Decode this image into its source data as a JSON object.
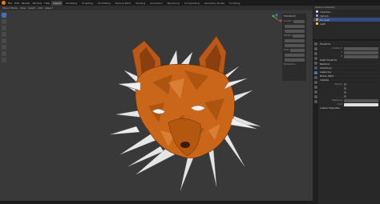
{
  "topbar": {
    "menus": [
      "File",
      "Edit",
      "Render",
      "Window",
      "Help"
    ],
    "workspaces": [
      "Layout",
      "Modeling",
      "Sculpting",
      "UV Editing",
      "Texture Paint",
      "Shading",
      "Animation",
      "Rendering",
      "Compositing",
      "Geometry Nodes",
      "Scripting"
    ],
    "active_workspace": "Layout"
  },
  "viewport": {
    "header_items": [
      "Object Mode",
      "View",
      "Select",
      "Add",
      "Object"
    ],
    "info_lines": [
      "User Perspective",
      "(1) Collection | fox_head"
    ],
    "npanel": {
      "title": "Transform",
      "rows": [
        "Location",
        "",
        "",
        "Rotation",
        "",
        "",
        "Scale",
        "",
        "",
        "Dimensions"
      ]
    }
  },
  "outliner": {
    "header": "Scene Collection",
    "rows": [
      {
        "label": "Collection",
        "selected": false
      },
      {
        "label": "Camera",
        "selected": false
      },
      {
        "label": "fox_head",
        "selected": true
      },
      {
        "label": "Light",
        "selected": false
      }
    ]
  },
  "properties": {
    "sections": [
      {
        "title": "Transform",
        "lines": [
          {
            "label": "Location X",
            "value": ""
          },
          {
            "label": "Y",
            "value": ""
          },
          {
            "label": "Z",
            "value": ""
          }
        ]
      },
      {
        "title": "Delta Transform",
        "lines": []
      },
      {
        "title": "Relations",
        "lines": []
      },
      {
        "title": "Collections",
        "lines": []
      },
      {
        "title": "Instancing",
        "lines": []
      },
      {
        "title": "Motion Paths",
        "lines": []
      },
      {
        "title": "Visibility",
        "lines": [
          {
            "label": "Show In",
            "value": ""
          },
          {
            "label": "",
            "value": ""
          },
          {
            "label": "",
            "value": ""
          },
          {
            "label": "",
            "value": ""
          },
          {
            "label": "Display As",
            "value": ""
          },
          {
            "label": "Color",
            "value": ""
          }
        ]
      },
      {
        "title": "Custom Properties",
        "lines": []
      }
    ]
  },
  "colors": {
    "accent": "#4772b3",
    "fox_orange": "#c9661a",
    "fox_dark": "#7a3a0c",
    "horn": "#e6e6e6"
  }
}
